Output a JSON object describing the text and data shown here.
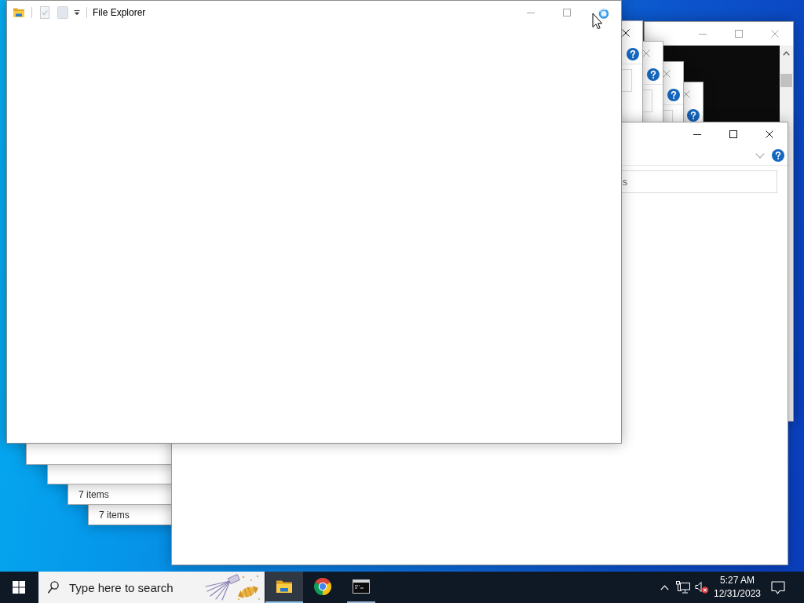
{
  "desktop": {
    "windows": [
      {
        "kind": "console",
        "active": false
      },
      {
        "kind": "explorer_cascade",
        "active": false,
        "status": "7 items"
      },
      {
        "kind": "explorer_cascade",
        "active": false,
        "status": "7 items"
      },
      {
        "kind": "explorer_cascade",
        "active": false
      },
      {
        "kind": "explorer_cascade",
        "active": true
      },
      {
        "kind": "explorer",
        "active": true,
        "search": {
          "placeholder": "s"
        }
      },
      {
        "kind": "explorer_opening",
        "active": false,
        "title": "File Explorer",
        "quick_access": [
          {
            "kind": "properties",
            "disabled": true
          },
          {
            "kind": "new_folder",
            "disabled": true
          }
        ]
      }
    ],
    "pointer": {
      "busy": true
    }
  },
  "taskbar": {
    "search": {
      "placeholder": "Type here to search"
    },
    "apps": [
      {
        "kind": "folder",
        "running": true,
        "selected": true
      },
      {
        "kind": "browser",
        "running": false,
        "selected": false
      },
      {
        "kind": "terminal",
        "running": true,
        "selected": false
      }
    ],
    "tray": {
      "volume_muted": true
    },
    "clock": {
      "time": "5:27 AM",
      "date": "12/31/2023"
    }
  }
}
